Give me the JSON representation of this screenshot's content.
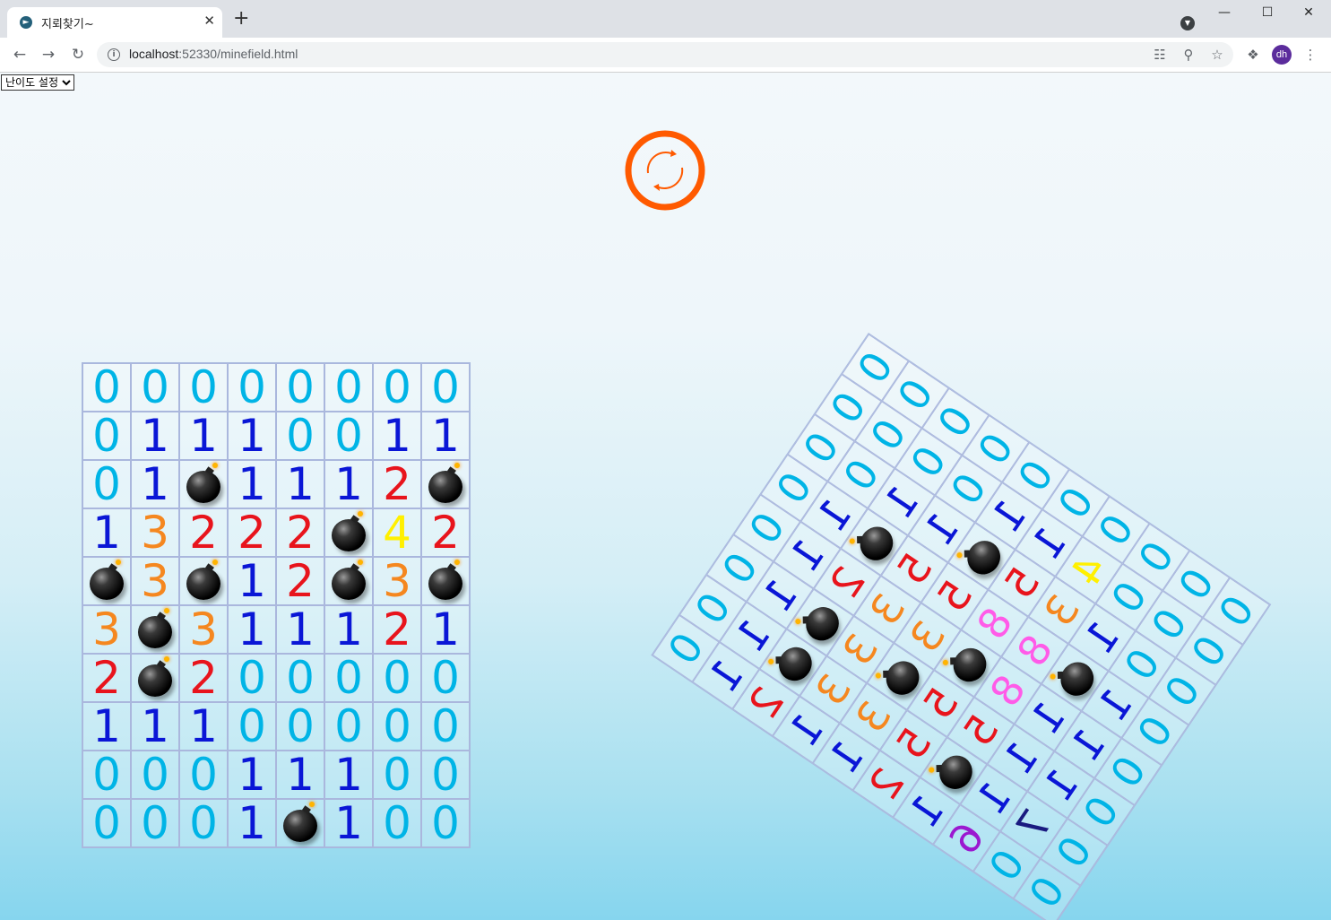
{
  "browser": {
    "tab_title": "지뢰찾기~",
    "url_host": "localhost",
    "url_rest": ":52330/minefield.html",
    "profile_initials": "dh"
  },
  "difficulty_select": {
    "selected": "난이도 설정"
  },
  "colors": {
    "0": "#00b4e6",
    "1": "#0a16d6",
    "2": "#e8141c",
    "3": "#f5871f",
    "4": "#fff000",
    "5": "#e8141c",
    "6": "#9b18d0",
    "7": "#1a1a80",
    "8": "#ff5be8",
    "reset_ring": "#ff5a00"
  },
  "board_left": {
    "rows": [
      [
        "0",
        "0",
        "0",
        "0",
        "0",
        "0",
        "0",
        "0"
      ],
      [
        "0",
        "1",
        "1",
        "1",
        "0",
        "0",
        "1",
        "1"
      ],
      [
        "0",
        "1",
        "*",
        "1",
        "1",
        "1",
        "2",
        "*"
      ],
      [
        "1",
        "3",
        "2",
        "2",
        "2",
        "*",
        "4",
        "2"
      ],
      [
        "*",
        "3",
        "*",
        "1",
        "2",
        "*",
        "3",
        "*"
      ],
      [
        "3",
        "*",
        "3",
        "1",
        "1",
        "1",
        "2",
        "1"
      ],
      [
        "2",
        "*",
        "2",
        "0",
        "0",
        "0",
        "0",
        "0"
      ],
      [
        "1",
        "1",
        "1",
        "0",
        "0",
        "0",
        "0",
        "0"
      ],
      [
        "0",
        "0",
        "0",
        "1",
        "1",
        "1",
        "0",
        "0"
      ],
      [
        "0",
        "0",
        "0",
        "1",
        "*",
        "1",
        "0",
        "0"
      ]
    ]
  },
  "board_right": {
    "rows": [
      [
        "0",
        "0",
        "0",
        "0",
        "0",
        "0",
        "0",
        "0"
      ],
      [
        "0",
        "0",
        "0",
        "1",
        "1",
        "1",
        "1",
        "1"
      ],
      [
        "0",
        "0",
        "1",
        "*",
        "2",
        "*",
        "*",
        "2"
      ],
      [
        "0",
        "0",
        "1",
        "5",
        "3",
        "3",
        "3",
        "1"
      ],
      [
        "0",
        "1",
        "*",
        "5",
        "3",
        "*",
        "3",
        "1"
      ],
      [
        "0",
        "1",
        "5",
        "8",
        "*",
        "5",
        "5",
        "2"
      ],
      [
        "0",
        "4",
        "3",
        "8",
        "8",
        "5",
        "*",
        "1"
      ],
      [
        "0",
        "0",
        "1",
        "*",
        "1",
        "1",
        "1",
        "6"
      ],
      [
        "0",
        "0",
        "0",
        "1",
        "1",
        "1",
        "7",
        "0"
      ],
      [
        "0",
        "0",
        "0",
        "0",
        "0",
        "0",
        "0",
        "0"
      ]
    ]
  }
}
